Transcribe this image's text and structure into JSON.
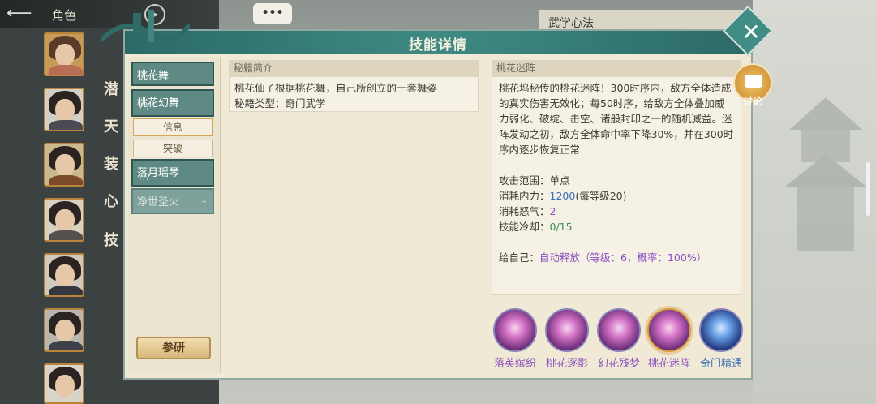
{
  "background": {
    "role_title": "角色",
    "side_labels": [
      "潜",
      "天",
      "装",
      "心",
      "技"
    ],
    "wuxue_title": "武学心法",
    "chat_bubble": "•••"
  },
  "modal": {
    "title": "技能详情",
    "close_label": "✕"
  },
  "skill_list": {
    "tabs": [
      {
        "label": "桃花舞",
        "bars": ""
      },
      {
        "label": "桃花幻舞",
        "bars": "///"
      },
      {
        "label": "落月瑶琴",
        "bars": "///"
      },
      {
        "label": "净世圣火",
        "bars": ""
      }
    ],
    "sub_buttons": [
      "信息",
      "突破"
    ],
    "research_button": "参研"
  },
  "miji": {
    "header": "秘籍简介",
    "description": "桃花仙子根据桃花舞，自己所创立的一套舞姿",
    "type_label": "秘籍类型：",
    "type_value": "奇门武学"
  },
  "detail": {
    "header": "桃花迷阵",
    "description": "桃花坞秘传的桃花迷阵！300时序内，敌方全体造成的真实伤害无效化；每50时序，给敌方全体叠加威力弱化、破绽、击空、诸般封印之一的随机减益。迷阵发动之初，敌方全体命中率下降30%，并在300时序内逐步恢复正常",
    "attack_range_label": "攻击范围：",
    "attack_range_value": "单点",
    "mp_cost_label": "消耗内力：",
    "mp_cost_value": "1200",
    "mp_cost_extra": "(每等级20)",
    "rage_cost_label": "消耗怒气：",
    "rage_cost_value": "2",
    "cooldown_label": "技能冷却：",
    "cooldown_value": "0/15",
    "self_label": "给自己：",
    "self_value": "自动释放（等级：6，概率：100%）"
  },
  "skill_icons": [
    {
      "name": "落英缤纷"
    },
    {
      "name": "桃花逐影"
    },
    {
      "name": "幻花残梦"
    },
    {
      "name": "桃花迷阵",
      "selected": true
    },
    {
      "name": "奇门精通"
    }
  ],
  "discuss": {
    "label": "讨论"
  },
  "colors": {
    "header_teal": "#3e8a82",
    "panel_bg": "#efe9d6",
    "accent_purple": "#8c4fc3",
    "accent_blue": "#3a6cb6",
    "accent_green": "#3f8c5a"
  }
}
